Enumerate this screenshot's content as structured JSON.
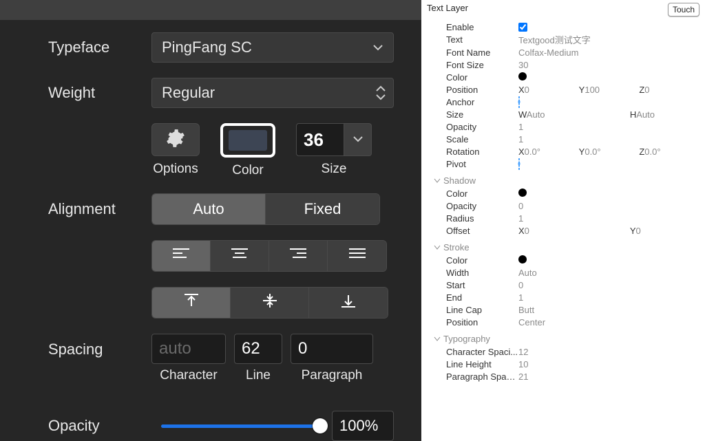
{
  "left": {
    "typeface": {
      "label": "Typeface",
      "value": "PingFang SC"
    },
    "weight": {
      "label": "Weight",
      "value": "Regular"
    },
    "options": {
      "label": "Options"
    },
    "color": {
      "label": "Color",
      "swatch": "#3d4554"
    },
    "size": {
      "label": "Size",
      "value": "36"
    },
    "alignment": {
      "label": "Alignment",
      "auto": "Auto",
      "fixed": "Fixed"
    },
    "spacing": {
      "label": "Spacing",
      "character": {
        "label": "Character",
        "value": "auto"
      },
      "line": {
        "label": "Line",
        "value": "62"
      },
      "paragraph": {
        "label": "Paragraph",
        "value": "0"
      }
    },
    "opacity": {
      "label": "Opacity",
      "value": "100%"
    }
  },
  "right": {
    "title": "Text Layer",
    "touch": "Touch",
    "main": {
      "enable": "Enable",
      "text": {
        "k": "Text",
        "v": "Textgood测试文字"
      },
      "fontName": {
        "k": "Font Name",
        "v": "Colfax-Medium"
      },
      "fontSize": {
        "k": "Font Size",
        "v": "30"
      },
      "color": {
        "k": "Color"
      },
      "position": {
        "k": "Position",
        "x": "0",
        "y": "100",
        "z": "0"
      },
      "anchor": {
        "k": "Anchor"
      },
      "size": {
        "k": "Size",
        "w": "Auto",
        "h": "Auto"
      },
      "opacity": {
        "k": "Opacity",
        "v": "1"
      },
      "scale": {
        "k": "Scale",
        "v": "1"
      },
      "rotation": {
        "k": "Rotation",
        "x": "0.0°",
        "y": "0.0°",
        "z": "0.0°"
      },
      "pivot": {
        "k": "Pivot"
      }
    },
    "sections": {
      "shadow": {
        "title": "Shadow",
        "color": {
          "k": "Color"
        },
        "opacity": {
          "k": "Opacity",
          "v": "0"
        },
        "radius": {
          "k": "Radius",
          "v": "1"
        },
        "offset": {
          "k": "Offset",
          "x": "0",
          "y": "0"
        }
      },
      "stroke": {
        "title": "Stroke",
        "color": {
          "k": "Color"
        },
        "width": {
          "k": "Width",
          "v": "Auto"
        },
        "start": {
          "k": "Start",
          "v": "0"
        },
        "end": {
          "k": "End",
          "v": "1"
        },
        "lineCap": {
          "k": "Line Cap",
          "v": "Butt"
        },
        "position": {
          "k": "Position",
          "v": "Center"
        }
      },
      "typography": {
        "title": "Typography",
        "charSpacing": {
          "k": "Character Spaci...",
          "v": "12"
        },
        "lineHeight": {
          "k": "Line Height",
          "v": "10"
        },
        "paraSpacing": {
          "k": "Paragraph Spaci...",
          "v": "21"
        }
      }
    }
  }
}
